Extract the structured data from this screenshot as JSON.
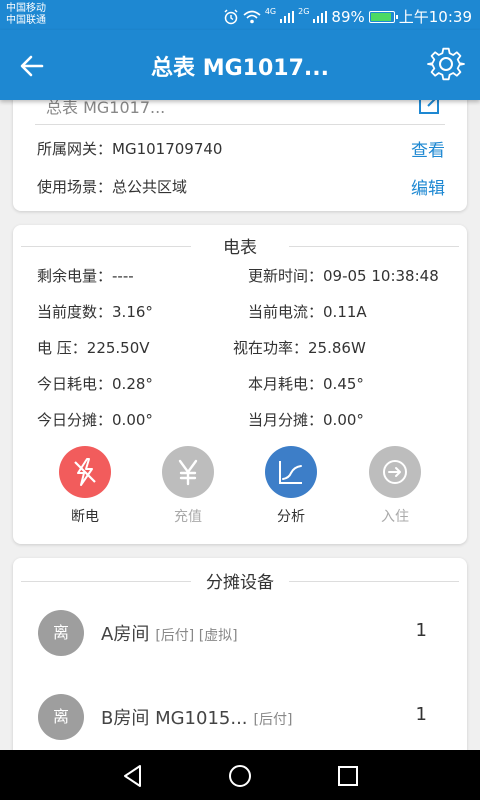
{
  "status_bar": {
    "carrier_1": "中国移动",
    "carrier_2": "中国联通",
    "net_1": "4G",
    "net_2": "2G",
    "battery": "89%",
    "time": "上午10:39"
  },
  "app_bar": {
    "title": "总表 MG1017...",
    "back_icon": "back-arrow-icon",
    "settings_icon": "gear-icon"
  },
  "gateway_card": {
    "partial_title": "总表 MG1017...",
    "gateway_label": "所属网关：",
    "gateway_value": "MG101709740",
    "gateway_link": "查看",
    "scene_label": "使用场景：",
    "scene_value": "总公共区域",
    "scene_link": "编辑"
  },
  "meter_card": {
    "title": "电表",
    "fields": [
      {
        "label": "剩余电量：",
        "value": "----"
      },
      {
        "label": "更新时间：",
        "value": "09-05 10:38:48"
      },
      {
        "label": "当前度数：",
        "value": "3.16°"
      },
      {
        "label": "当前电流：",
        "value": "0.11A"
      },
      {
        "label": "电 压：",
        "value": "225.50V"
      },
      {
        "label": "视在功率：",
        "value": "25.86W"
      },
      {
        "label": "今日耗电：",
        "value": "0.28°"
      },
      {
        "label": "本月耗电：",
        "value": "0.45°"
      },
      {
        "label": "今日分摊：",
        "value": "0.00°"
      },
      {
        "label": "当月分摊：",
        "value": "0.00°"
      }
    ],
    "actions": [
      {
        "label": "断电",
        "icon": "power-off-icon",
        "color": "#f25c5c",
        "enabled": true
      },
      {
        "label": "充值",
        "icon": "yen-icon",
        "color": "#bdbdbd",
        "enabled": false
      },
      {
        "label": "分析",
        "icon": "chart-line-icon",
        "color": "#3d7ec8",
        "enabled": true
      },
      {
        "label": "入住",
        "icon": "check-in-icon",
        "color": "#bdbdbd",
        "enabled": false
      }
    ]
  },
  "share_card": {
    "title": "分摊设备",
    "devices": [
      {
        "avatar": "离",
        "name": "A房间",
        "tags": "[后付] [虚拟]",
        "count": "1"
      },
      {
        "avatar": "离",
        "name": "B房间 MG1015...",
        "tags": "[后付]",
        "count": "1"
      }
    ]
  },
  "colors": {
    "primary": "#1e88d2",
    "link": "#1e88d2",
    "danger": "#f25c5c",
    "disabled": "#bdbdbd"
  }
}
